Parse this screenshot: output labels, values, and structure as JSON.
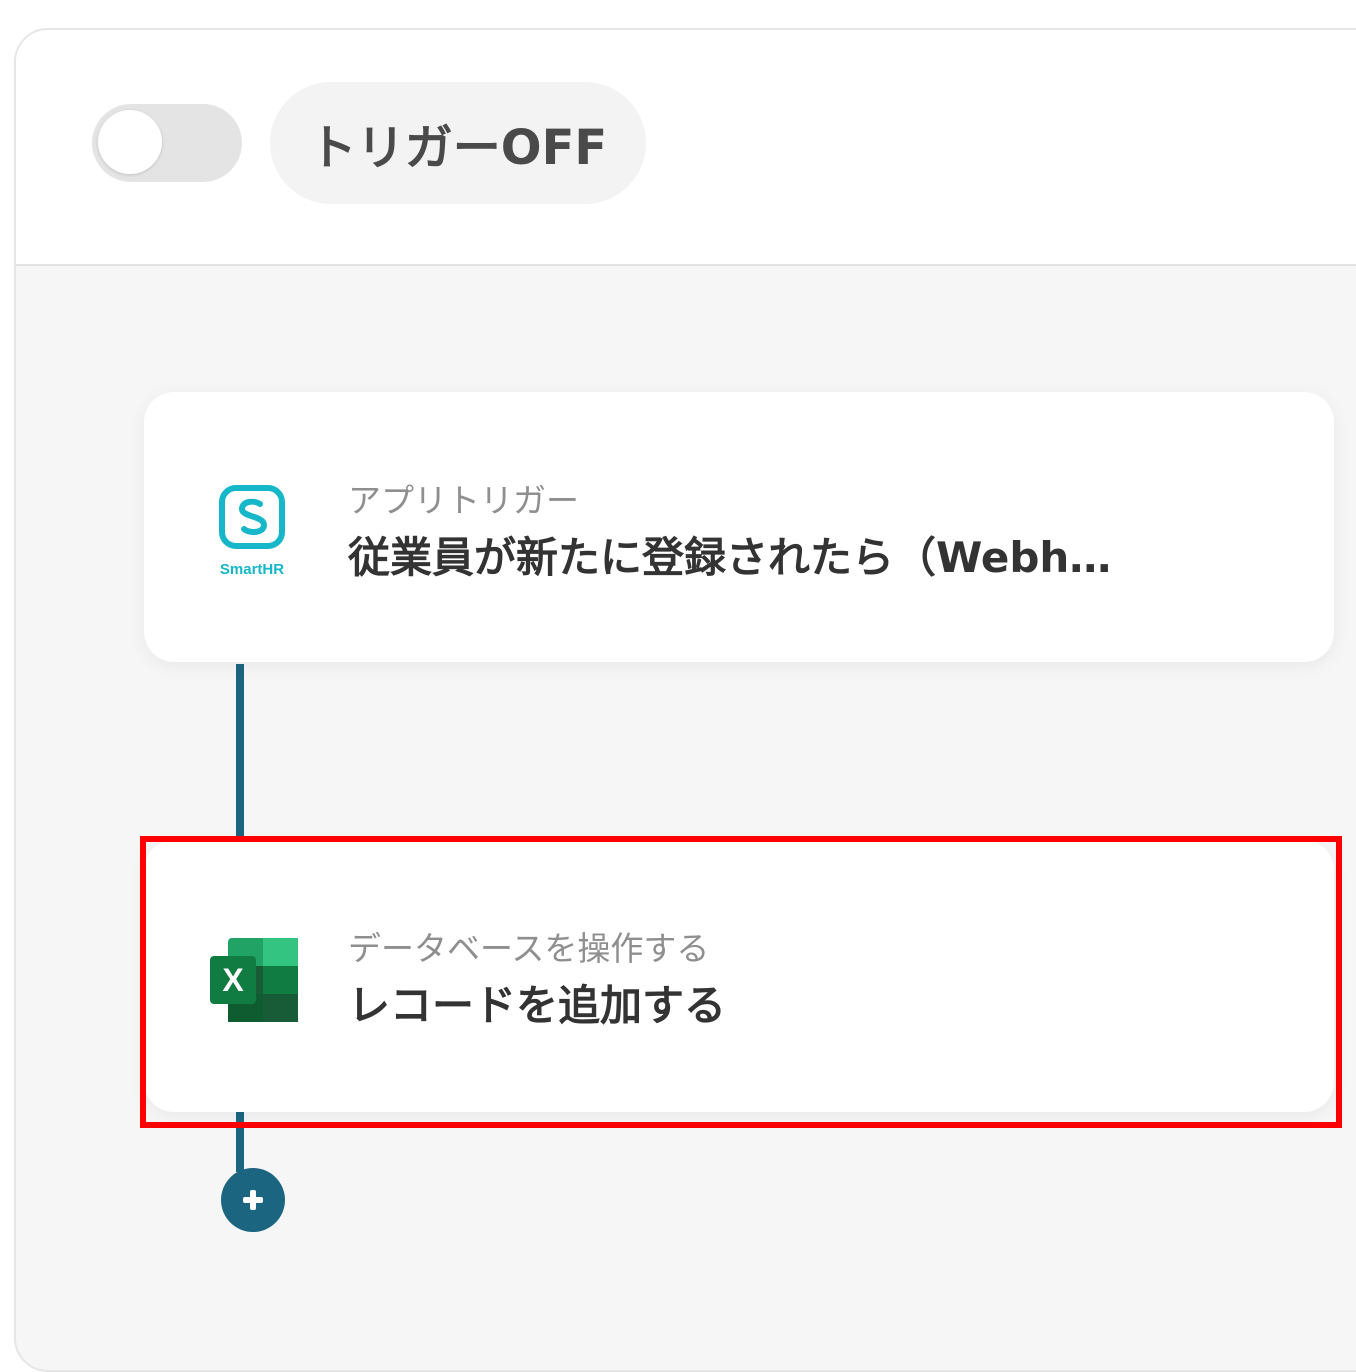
{
  "header": {
    "trigger_toggle_state": "off",
    "trigger_status_label": "トリガーOFF"
  },
  "flow": {
    "steps": [
      {
        "app": "SmartHR",
        "icon": "smarthr-logo-icon",
        "subtitle": "アプリトリガー",
        "title": "従業員が新たに登録されたら（Webh…"
      },
      {
        "app": "Microsoft Excel",
        "icon": "excel-logo-icon",
        "subtitle": "データベースを操作する",
        "title": "レコードを追加する"
      }
    ],
    "add_step_icon": "plus-icon"
  },
  "colors": {
    "connector": "#1c6580",
    "highlight": "#ff0000",
    "smarthr_brand": "#16b7c9",
    "excel_brand": "#1e7a45"
  }
}
